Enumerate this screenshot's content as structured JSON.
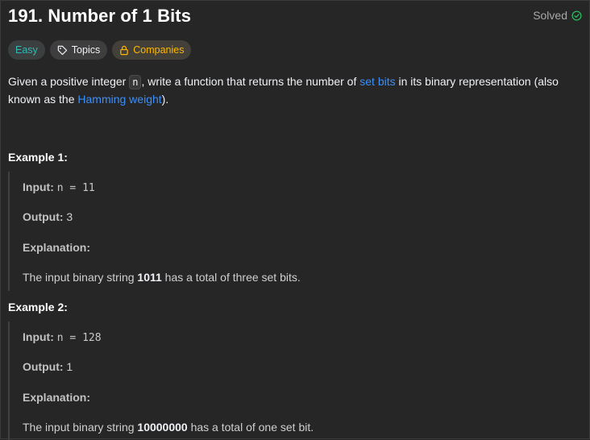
{
  "problem": {
    "title": "191. Number of 1 Bits",
    "status": "Solved"
  },
  "tags": {
    "difficulty": "Easy",
    "topics": "Topics",
    "companies": "Companies"
  },
  "description": {
    "part1": "Given a positive integer ",
    "code_n": "n",
    "part2": ", write a function that returns the number of ",
    "link_set_bits": "set bits",
    "part3": " in its binary representation (also known as the ",
    "link_hamming": "Hamming weight",
    "part4": ")."
  },
  "examples": [
    {
      "title": "Example 1:",
      "input_label": "Input:",
      "input_value": "n = 11",
      "output_label": "Output:",
      "output_value": "3",
      "explanation_label": "Explanation:",
      "explanation_pre": "The input binary string ",
      "explanation_bold": "1011",
      "explanation_post": " has a total of three set bits."
    },
    {
      "title": "Example 2:",
      "input_label": "Input:",
      "input_value": "n = 128",
      "output_label": "Output:",
      "output_value": "1",
      "explanation_label": "Explanation:",
      "explanation_pre": "The input binary string ",
      "explanation_bold": "10000000",
      "explanation_post": " has a total of one set bit."
    }
  ],
  "colors": {
    "easy": "#2cbbb4",
    "companies": "#ffb700",
    "link": "#3b8ffa",
    "solved_check": "#2cbb5d"
  }
}
